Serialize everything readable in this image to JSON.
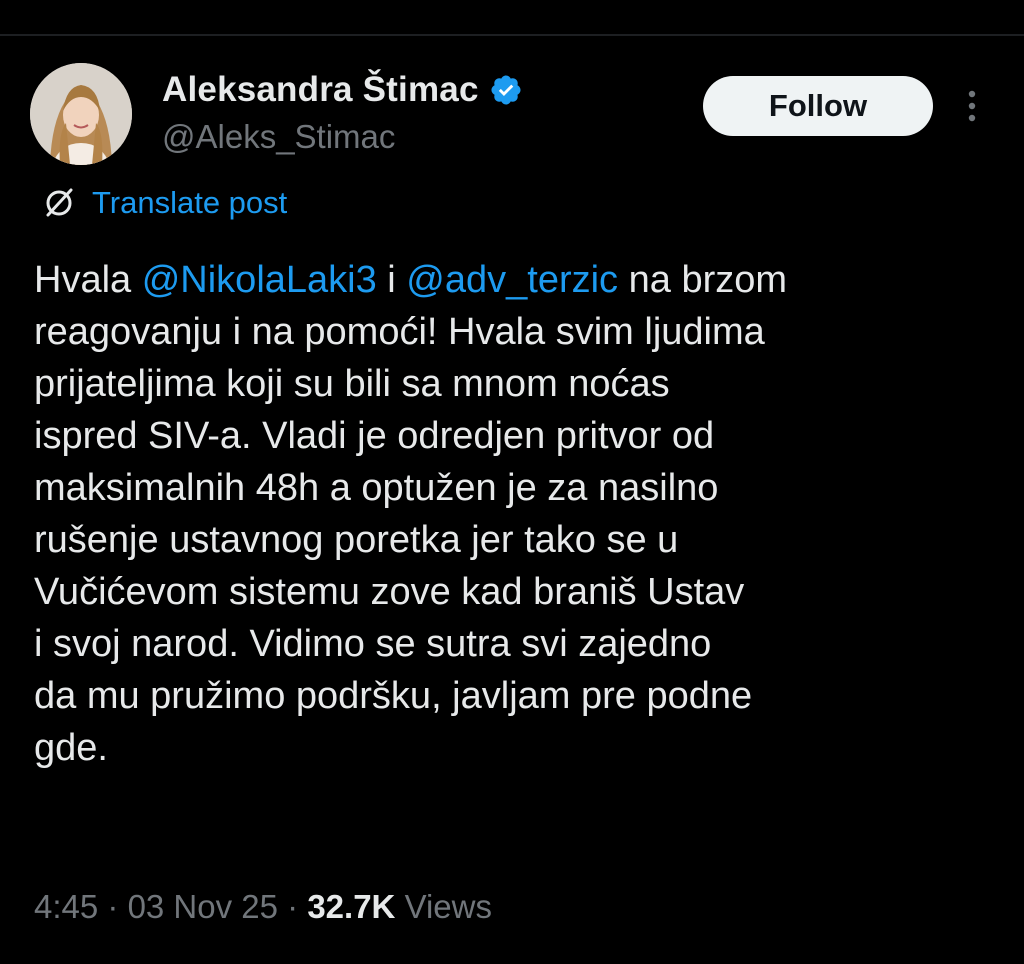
{
  "author": {
    "display_name": "Aleksandra Štimac",
    "handle": "@Aleks_Stimac",
    "verified_icon": "verified-badge-icon",
    "avatar_icon": "profile-photo"
  },
  "actions": {
    "follow_label": "Follow",
    "more_icon": "more-vertical-icon"
  },
  "translate": {
    "label": "Translate post",
    "icon": "translate-icon"
  },
  "post": {
    "lines": [
      [
        {
          "t": "Hvala "
        },
        {
          "t": "@NikolaLaki3",
          "mention": true
        },
        {
          "t": " i "
        },
        {
          "t": "@adv_terzic",
          "mention": true
        },
        {
          "t": " na brzom"
        }
      ],
      [
        {
          "t": "reagovanju i na pomoći! Hvala svim ljudima"
        }
      ],
      [
        {
          "t": "prijateljima koji su bili sa mnom noćas"
        }
      ],
      [
        {
          "t": "ispred SIV-a. Vladi je odredjen pritvor od"
        }
      ],
      [
        {
          "t": "maksimalnih 48h a optužen je za nasilno"
        }
      ],
      [
        {
          "t": "rušenje ustavnog poretka jer tako se u"
        }
      ],
      [
        {
          "t": "Vučićevom sistemu zove kad braniš Ustav"
        }
      ],
      [
        {
          "t": "i svoj narod. Vidimo se sutra svi zajedno"
        }
      ],
      [
        {
          "t": "da mu pružimo podršku, javljam pre podne"
        }
      ],
      [
        {
          "t": "gde."
        }
      ]
    ]
  },
  "meta": {
    "time": "4:45",
    "date": "03 Nov 25",
    "separator": " · ",
    "views_count": "32.7K",
    "views_label": "Views"
  },
  "colors": {
    "background": "#000000",
    "text": "#e7e9ea",
    "secondary": "#71767b",
    "accent": "#1d9bf0",
    "button_bg": "#eff3f4"
  }
}
